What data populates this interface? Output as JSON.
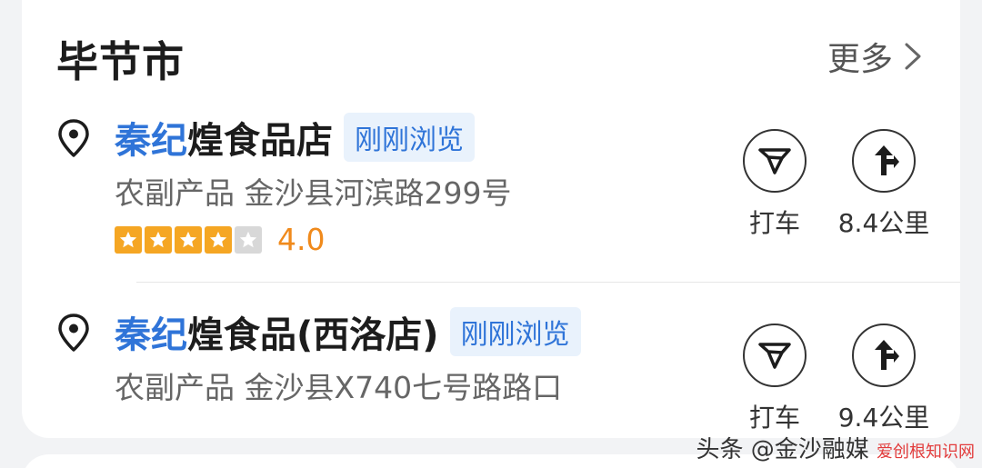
{
  "header": {
    "city": "毕节市",
    "more_label": "更多"
  },
  "results": [
    {
      "name_highlight": "秦纪",
      "name_rest": "煌食品店",
      "tag": "刚刚浏览",
      "category": "农副产品",
      "address": "金沙县河滨路299号",
      "rating": 4,
      "rating_max": 5,
      "score": "4.0",
      "taxi_label": "打车",
      "distance": "8.4公里"
    },
    {
      "name_highlight": "秦纪",
      "name_rest": "煌食品(西洛店)",
      "tag": "刚刚浏览",
      "category": "农副产品",
      "address": "金沙县X740七号路路口",
      "taxi_label": "打车",
      "distance": "9.4公里"
    }
  ],
  "watermark": {
    "text": "头条 @金沙融媒",
    "sub": "爱创根知识网"
  },
  "icons": {
    "pin": "location-pin-icon",
    "taxi": "taxi-icon",
    "route": "route-arrow-icon",
    "chevron": "chevron-right-icon",
    "star": "star-icon"
  },
  "colors": {
    "highlight": "#2f74d8",
    "tag_bg": "#e9f2fc",
    "star": "#f5a623",
    "score": "#f08a1c"
  }
}
